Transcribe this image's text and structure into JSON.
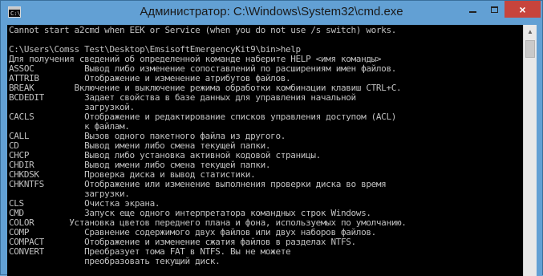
{
  "window": {
    "title": "Администратор: C:\\Windows\\System32\\cmd.exe",
    "icon": "cmd-icon",
    "controls": {
      "minimize": "minimize-icon",
      "maximize": "maximize-icon",
      "close": "×"
    }
  },
  "console": {
    "lines": [
      "Cannot start a2cmd when EEK or Service (when you do not use /s switch) works.",
      "",
      "C:\\Users\\Comss Test\\Desktop\\EmsisoftEmergencyKit9\\bin>help",
      "Для получения сведений об определенной команде наберите HELP <имя команды>",
      "ASSOC          Вывод либо изменение сопоставлений по расширениям имен файлов.",
      "ATTRIB         Отображение и изменение атрибутов файлов.",
      "BREAK        Включение и выключение режима обработки комбинации клавиш CTRL+C.",
      "BCDEDIT        Задает свойства в базе данных для управления начальной",
      "               загрузкой.",
      "CACLS          Отображение и редактирование списков управления доступом (ACL)",
      "               к файлам.",
      "CALL           Вызов одного пакетного файла из другого.",
      "CD             Вывод имени либо смена текущей папки.",
      "CHCP           Вывод либо установка активной кодовой страницы.",
      "CHDIR          Вывод имени либо смена текущей папки.",
      "CHKDSK         Проверка диска и вывод статистики.",
      "CHKNTFS        Отображение или изменение выполнения проверки диска во время",
      "               загрузки.",
      "CLS            Очистка экрана.",
      "CMD            Запуск еще одного интерпретатора командных строк Windows.",
      "COLOR       Установка цветов переднего плана и фона, используемых по умолчанию.",
      "COMP           Сравнение содержимого двух файлов или двух наборов файлов.",
      "COMPACT        Отображение и изменение сжатия файлов в разделах NTFS.",
      "CONVERT        Преобразует тома FAT в NTFS. Вы не можете",
      "               преобразовать текущий диск."
    ]
  }
}
